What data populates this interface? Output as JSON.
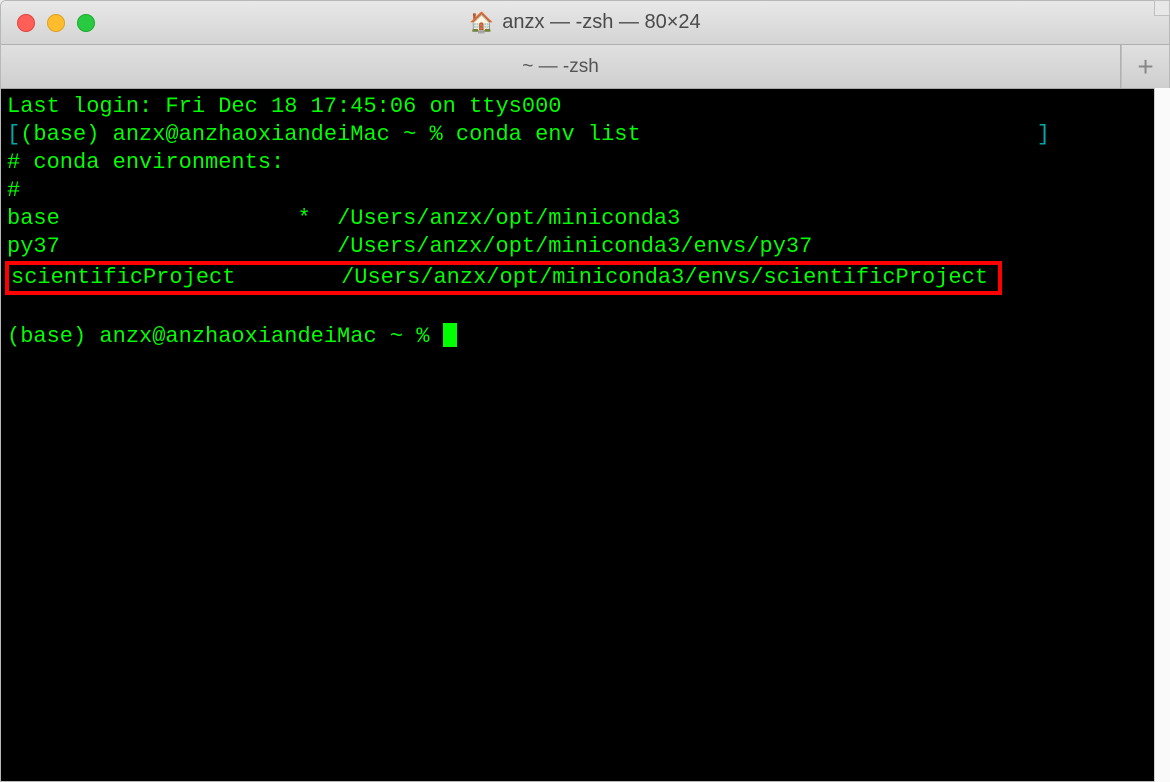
{
  "titlebar": {
    "home_icon": "🏠",
    "title": "anzx — -zsh — 80×24"
  },
  "tabbar": {
    "tab_label": "~ — -zsh",
    "new_tab_label": "+"
  },
  "terminal": {
    "last_login": "Last login: Fri Dec 18 17:45:06 on ttys000",
    "prompt_bracket_open": "[",
    "prompt_bracket_close": "]",
    "prompt_user": "(base) anzx@anzhaoxiandeiMac ~ % ",
    "command": "conda env list",
    "header1": "# conda environments:",
    "header2": "#",
    "envs": [
      {
        "name": "base",
        "active_marker": "*",
        "path": "/Users/anzx/opt/miniconda3"
      },
      {
        "name": "py37",
        "active_marker": " ",
        "path": "/Users/anzx/opt/miniconda3/envs/py37"
      },
      {
        "name": "scientificProject",
        "active_marker": " ",
        "path": "/Users/anzx/opt/miniconda3/envs/scientificProject"
      }
    ],
    "prompt2": "(base) anzx@anzhaoxiandeiMac ~ % "
  }
}
